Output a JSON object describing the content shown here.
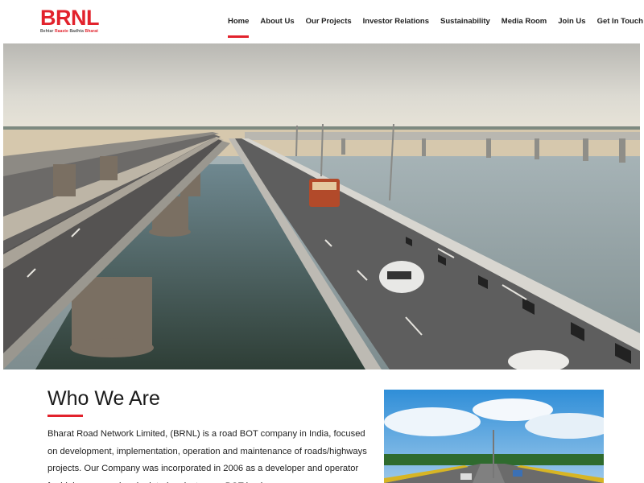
{
  "brand": {
    "logo_text": "BRNL",
    "tagline_1": "Behtar",
    "tagline_2": "Raaste",
    "tagline_3": "Badhta",
    "tagline_4": "Bharat",
    "accent_color": "#e2222c"
  },
  "nav": {
    "items": [
      {
        "label": "Home",
        "active": true
      },
      {
        "label": "About Us"
      },
      {
        "label": "Our Projects"
      },
      {
        "label": "Investor Relations"
      },
      {
        "label": "Sustainability"
      },
      {
        "label": "Media Room"
      },
      {
        "label": "Join Us"
      },
      {
        "label": "Get In Touch"
      }
    ]
  },
  "about": {
    "heading": "Who We Are",
    "body": "Bharat Road Network Limited, (BRNL) is a road BOT company in India, focused on development, implementation, operation and maintenance of roads/highways projects. Our Company was incorporated in 2006 as a developer and operator for highways, road and related projects on a BOT basis."
  }
}
